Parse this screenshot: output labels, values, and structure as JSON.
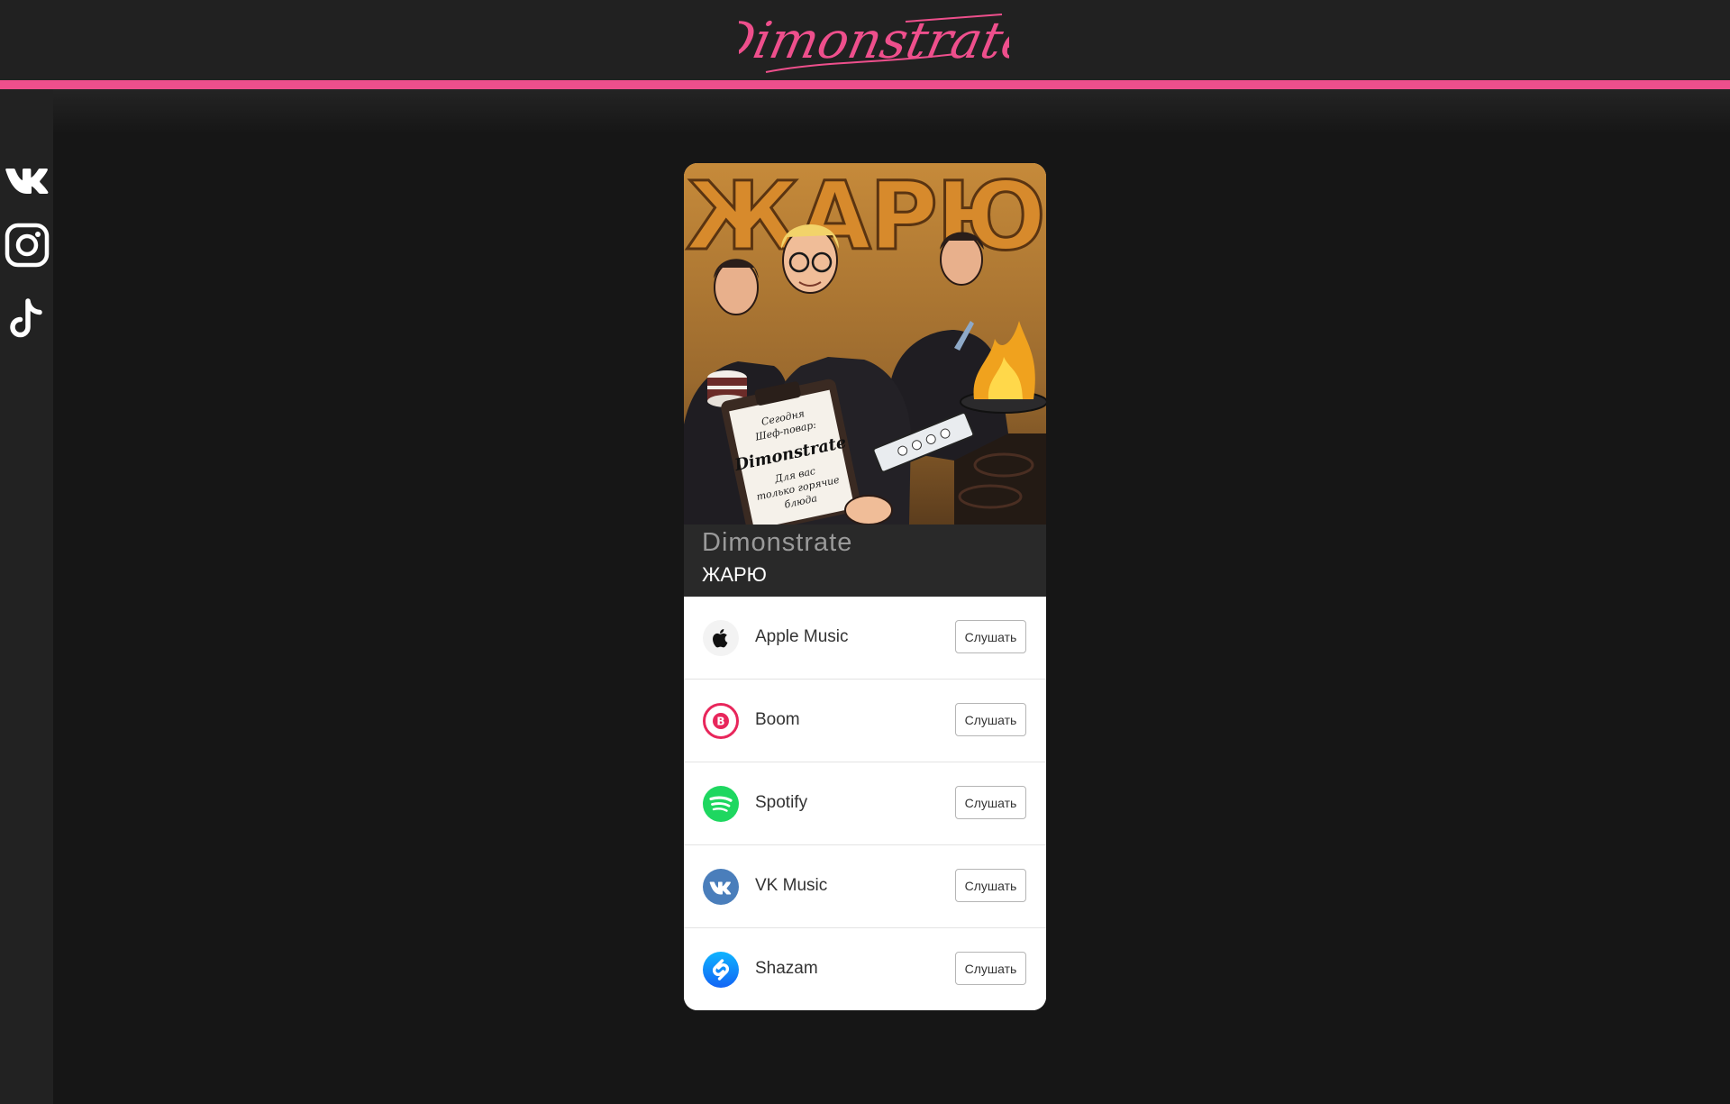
{
  "header": {
    "logo_text": "Dimonstrate"
  },
  "sidebar": {
    "links": [
      {
        "name": "vk",
        "icon": "vk-icon"
      },
      {
        "name": "instagram",
        "icon": "instagram-icon"
      },
      {
        "name": "tiktok",
        "icon": "tiktok-icon"
      }
    ]
  },
  "release": {
    "cover": {
      "title_text": "ЖАРЮ",
      "note_lines": [
        "Сегодня",
        "Шеф-повар:",
        "Dimonstrate",
        "Для вас",
        "только горячие",
        "блюда"
      ]
    },
    "artist": "Dimonstrate",
    "track": "ЖАРЮ"
  },
  "services": [
    {
      "name": "Apple Music",
      "icon": "apple-music-icon",
      "button": "Слушать"
    },
    {
      "name": "Boom",
      "icon": "boom-icon",
      "button": "Слушать"
    },
    {
      "name": "Spotify",
      "icon": "spotify-icon",
      "button": "Слушать"
    },
    {
      "name": "VK Music",
      "icon": "vk-music-icon",
      "button": "Слушать"
    },
    {
      "name": "Shazam",
      "icon": "shazam-icon",
      "button": "Слушать"
    }
  ],
  "colors": {
    "accent_pink": "#ee4f8c",
    "header_bg": "#212121",
    "page_bg": "#161616",
    "boom_red": "#e8265b",
    "spotify_green": "#1ed760",
    "vk_blue": "#4a7ebb",
    "shazam_blue": "#1a8ff5"
  }
}
